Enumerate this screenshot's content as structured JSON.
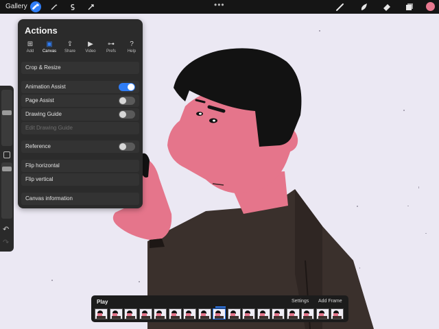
{
  "topbar": {
    "gallery_label": "Gallery",
    "left_tools": [
      "wrench-icon",
      "magic-wand-icon",
      "selection-icon",
      "transform-icon"
    ],
    "more_dots": "•••",
    "right_tools": [
      "brush-icon",
      "smudge-icon",
      "eraser-icon",
      "layers-icon"
    ],
    "current_color": "#e8788f",
    "accent_color": "#2f7df6"
  },
  "actions_panel": {
    "title": "Actions",
    "tabs": [
      {
        "label": "Add",
        "icon": "add-icon"
      },
      {
        "label": "Canvas",
        "icon": "canvas-icon"
      },
      {
        "label": "Share",
        "icon": "share-icon"
      },
      {
        "label": "Video",
        "icon": "video-icon"
      },
      {
        "label": "Prefs",
        "icon": "toggle-icon"
      },
      {
        "label": "Help",
        "icon": "help-icon"
      }
    ],
    "active_tab": "Canvas",
    "items": {
      "crop_resize": "Crop & Resize",
      "animation_assist": "Animation Assist",
      "page_assist": "Page Assist",
      "drawing_guide": "Drawing Guide",
      "edit_drawing_guide": "Edit Drawing Guide",
      "reference": "Reference",
      "flip_horizontal": "Flip horizontal",
      "flip_vertical": "Flip vertical",
      "canvas_information": "Canvas information"
    },
    "toggle_states": {
      "animation_assist": true,
      "page_assist": false,
      "drawing_guide": false,
      "reference": false
    }
  },
  "animation_bar": {
    "play_label": "Play",
    "settings_label": "Settings",
    "add_frame_label": "Add Frame",
    "frame_count": 17,
    "current_frame": 9
  }
}
